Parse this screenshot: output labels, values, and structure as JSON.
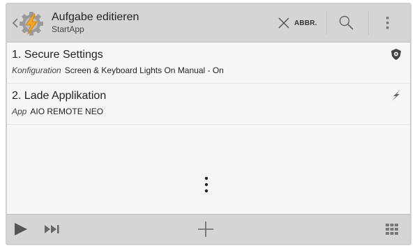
{
  "actionbar": {
    "title": "Aufgabe editieren",
    "subtitle": "StartApp",
    "icons": {
      "up": "chevron-left-icon",
      "app": "tasker-app-icon",
      "cancel": "close-icon",
      "search": "search-icon",
      "overflow": "more-vertical-icon"
    },
    "abbr_label": "ABBR."
  },
  "actions": [
    {
      "number": "1.",
      "name": "Secure Settings",
      "category": "Konfiguration",
      "detail": "Screen & Keyboard Lights On Manual - On",
      "icon": "shield-icon"
    },
    {
      "number": "2.",
      "name": "Lade Applikation",
      "category": "App",
      "detail": "AIO REMOTE NEO",
      "icon": "lightning-icon"
    }
  ],
  "bottombar": {
    "icons": [
      "play-icon",
      "step-forward-icon",
      "plus-icon",
      "grid-icon"
    ]
  },
  "colors": {
    "bar": "#d5d5d5",
    "background": "#f7f7f7",
    "icon_orange": "#f5a623"
  }
}
